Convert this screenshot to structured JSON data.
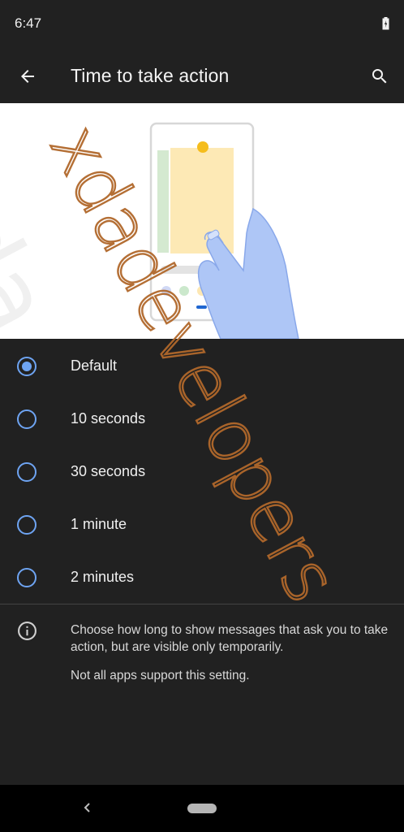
{
  "status_bar": {
    "time": "6:47"
  },
  "app_bar": {
    "title": "Time to take action"
  },
  "options": [
    {
      "label": "Default",
      "checked": true
    },
    {
      "label": "10 seconds",
      "checked": false
    },
    {
      "label": "30 seconds",
      "checked": false
    },
    {
      "label": "1 minute",
      "checked": false
    },
    {
      "label": "2 minutes",
      "checked": false
    }
  ],
  "info": {
    "description": "Choose how long to show messages that ask you to take action, but are visible only temporarily.",
    "note": "Not all apps support this setting."
  },
  "watermark": {
    "text": "xdadevelopers"
  },
  "colors": {
    "accent": "#6ea4f2",
    "background": "#212121",
    "watermark": "#b1682b"
  }
}
